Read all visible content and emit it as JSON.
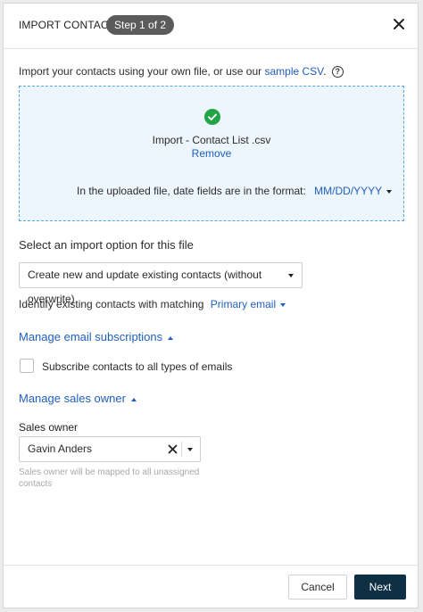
{
  "header": {
    "title": "IMPORT CONTACTS",
    "step_badge": "Step 1 of 2",
    "close_icon": "close-icon"
  },
  "intro": {
    "text": "Import your contacts using your own file, or use our ",
    "link": "sample CSV",
    "suffix": ".",
    "help_icon": "question-circle-icon",
    "help_glyph": "?"
  },
  "upload": {
    "status_icon": "check-circle-icon",
    "file_name": "Import - Contact List .csv",
    "remove_label": "Remove",
    "date_format_label": "In the uploaded file, date fields are in the format:",
    "date_format_value": "MM/DD/YYYY"
  },
  "import_option": {
    "label": "Select an import option for this file",
    "selected": "Create new and update existing contacts (without overwrite)"
  },
  "matching": {
    "label": "Identify existing contacts with matching",
    "value": "Primary email"
  },
  "email_subscriptions": {
    "heading": "Manage email subscriptions",
    "checkbox_label": "Subscribe contacts to all types of emails",
    "checked": false
  },
  "sales_owner": {
    "heading": "Manage sales owner",
    "field_label": "Sales owner",
    "value": "Gavin Anders",
    "help_text": "Sales owner will be mapped to all unassigned contacts"
  },
  "footer": {
    "cancel_label": "Cancel",
    "next_label": "Next"
  },
  "colors": {
    "accent_link": "#1f5fbf",
    "success": "#21a446",
    "primary_button": "#0f2f45",
    "dropzone_bg": "#eef6fd",
    "dropzone_border": "#5aa6e0"
  }
}
